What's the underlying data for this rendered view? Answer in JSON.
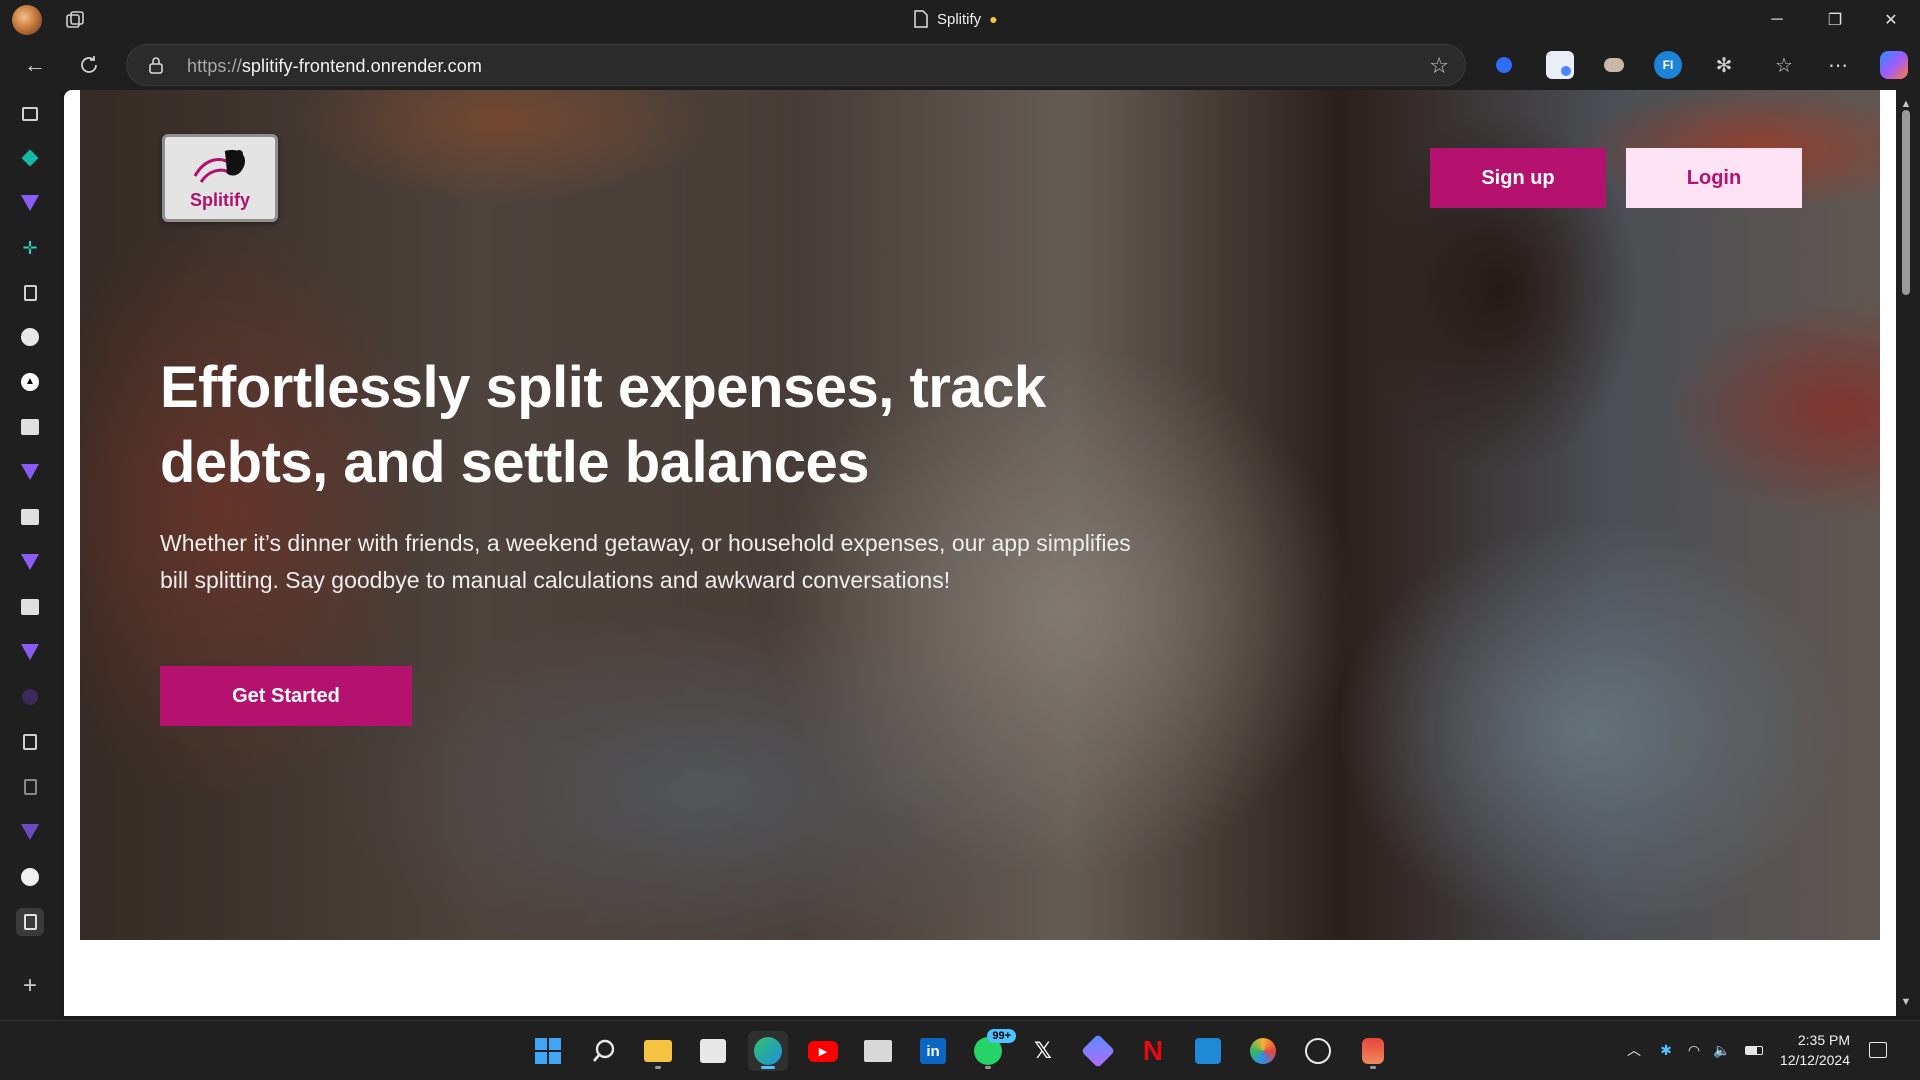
{
  "browser": {
    "tab_title": "Splitify",
    "url_protocol": "https://",
    "url_host": "splitify-frontend.onrender.com"
  },
  "page": {
    "logo_text": "Splitify",
    "signup_label": "Sign up",
    "login_label": "Login",
    "headline": "Effortlessly split expenses, track debts, and settle balances",
    "subtext": "Whether it’s dinner with friends, a weekend getaway, or household expenses, our app simplifies bill splitting. Say goodbye to manual calculations and awkward conversations!",
    "cta_label": "Get Started",
    "brand_color": "#b5116f",
    "login_bg": "#fde3f3"
  },
  "sidebar_icons": [
    "tabs-icon",
    "diamond-icon",
    "gemini-icon",
    "sparkle-icon",
    "page-icon",
    "moon-icon",
    "triangle-icon",
    "picture-icon",
    "gemini-icon",
    "picture-icon",
    "gemini-icon",
    "picture-icon",
    "gemini-icon",
    "circle-icon",
    "badge-page-icon",
    "page-icon",
    "gemini-icon",
    "github-icon",
    "page-icon",
    "add-icon"
  ],
  "extension_icons": [
    "record-icon",
    "edit-icon",
    "incognito-icon",
    "fi-icon",
    "puzzle-icon",
    "favorites-icon",
    "more-icon",
    "copilot-icon"
  ],
  "taskbar": {
    "apps": [
      "windows-start-icon",
      "search-icon",
      "file-explorer-icon",
      "store-icon",
      "edge-icon",
      "youtube-icon",
      "mail-icon",
      "linkedin-icon",
      "whatsapp-icon",
      "x-icon",
      "copilot-app-icon",
      "netflix-icon",
      "vscode-icon",
      "photos-icon",
      "chatgpt-icon",
      "snipping-tool-icon"
    ],
    "whatsapp_badge": "99+",
    "time": "2:35 PM",
    "date": "12/12/2024"
  }
}
